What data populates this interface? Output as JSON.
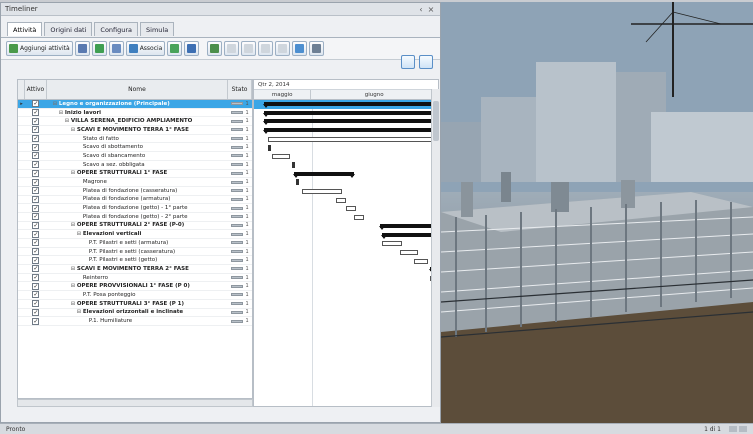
{
  "window": {
    "title": "Timeliner",
    "controls": [
      "‹",
      "×"
    ]
  },
  "tabs": [
    "Attività",
    "Origini dati",
    "Configura",
    "Simula"
  ],
  "active_tab": 0,
  "toolbar": {
    "add_activity_label": "Aggiungi attività",
    "attach_label": "Associa",
    "icons": [
      "add-activity-icon",
      "remove-icon",
      "insert-icon",
      "outdent-icon",
      "indent-icon",
      "attach-icon",
      "detach-icon",
      "filter-icon",
      "move-up-icon",
      "move-down-icon",
      "zoom-icon",
      "find-icon",
      "columns-icon",
      "gantt-view-icon",
      "grid-view-icon"
    ]
  },
  "grid": {
    "headers": {
      "active": "Attivo",
      "name": "Nome",
      "status": "Stato"
    },
    "rows": [
      {
        "name": "Legno e organizzazione (Principale)",
        "level": 0,
        "exp": "⊟",
        "bold": true,
        "selected": true,
        "marker": "▸"
      },
      {
        "name": "Inizio lavori",
        "level": 1,
        "exp": "⊟",
        "bold": true
      },
      {
        "name": "VILLA SERENA_EDIFICIO AMPLIAMENTO",
        "level": 2,
        "exp": "⊟",
        "bold": true
      },
      {
        "name": "SCAVI E MOVIMENTO TERRA 1° FASE",
        "level": 3,
        "exp": "⊟",
        "bold": true
      },
      {
        "name": "Stato di fatto",
        "level": 4
      },
      {
        "name": "Scavo di sbottamento",
        "level": 4
      },
      {
        "name": "Scavo di sbancamento",
        "level": 4
      },
      {
        "name": "Scavo a sez. obbligata",
        "level": 4
      },
      {
        "name": "OPERE STRUTTURALI 1° FASE",
        "level": 3,
        "exp": "⊟",
        "bold": true
      },
      {
        "name": "Magrone",
        "level": 4
      },
      {
        "name": "Platea di fondazione (casseratura)",
        "level": 4
      },
      {
        "name": "Platea di fondazione (armatura)",
        "level": 4
      },
      {
        "name": "Platea di fondazione (getto) - 1° parte",
        "level": 4
      },
      {
        "name": "Platea di fondazione (getto) - 2° parte",
        "level": 4
      },
      {
        "name": "OPERE STRUTTURALI 2° FASE (P-0)",
        "level": 3,
        "exp": "⊟",
        "bold": true
      },
      {
        "name": "Elevazioni verticali",
        "level": 4,
        "exp": "⊟",
        "bold": true
      },
      {
        "name": "P.T. Pilastri e setti (armatura)",
        "level": 5
      },
      {
        "name": "P.T. Pilastri e setti (casseratura)",
        "level": 5
      },
      {
        "name": "P.T. Pilastri e setti (getto)",
        "level": 5
      },
      {
        "name": "SCAVI E MOVIMENTO TERRA 2° FASE",
        "level": 3,
        "exp": "⊟",
        "bold": true
      },
      {
        "name": "Reinterro",
        "level": 4
      },
      {
        "name": "OPERE PROVVISIONALI 1° FASE (P 0)",
        "level": 3,
        "exp": "⊟",
        "bold": true
      },
      {
        "name": "P.T. Posa ponteggio",
        "level": 4
      },
      {
        "name": "OPERE STRUTTURALI 3° FASE (P 1)",
        "level": 3,
        "exp": "⊟",
        "bold": true
      },
      {
        "name": "Elevazioni orizzontali e inclinate",
        "level": 4,
        "exp": "⊟",
        "bold": true
      },
      {
        "name": "P.1. Humiliature",
        "level": 5
      }
    ],
    "status_nums": [
      "1",
      "1",
      "1",
      "1",
      "1",
      "1",
      "1",
      "1",
      "1",
      "1",
      "1",
      "1",
      "1",
      "1",
      "1",
      "1",
      "1",
      "1",
      "1",
      "1",
      "1",
      "1",
      "1",
      "1",
      "1",
      "1"
    ]
  },
  "gantt": {
    "quarter": "Qtr 2, 2014",
    "months": [
      "maggio",
      "giugno"
    ]
  },
  "status_bar": {
    "text": "Pronto",
    "page": "1 di 1"
  }
}
